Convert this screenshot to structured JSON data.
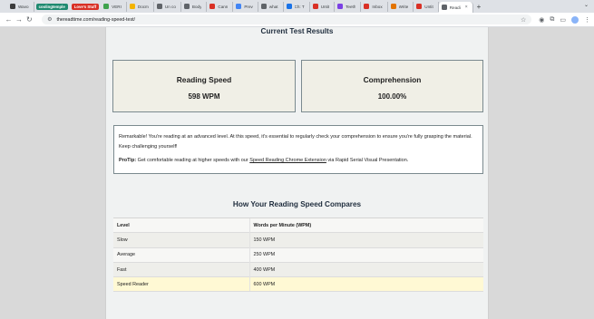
{
  "browser": {
    "tabs": [
      {
        "title": "Wavo",
        "color": "#3c3c3c"
      },
      {
        "pill": "coolingtemple",
        "color": "#1f8a70"
      },
      {
        "pill": "Love's Stuff",
        "color": "#d93025"
      },
      {
        "title": "VERI",
        "color": "#3fa34d"
      },
      {
        "title": "Docm",
        "color": "#f4b400"
      },
      {
        "title": "Un co",
        "color": "#5f6368"
      },
      {
        "title": "Body",
        "color": "#5f6368"
      },
      {
        "title": "Cann",
        "color": "#d93025"
      },
      {
        "title": "Prev",
        "color": "#4285f4"
      },
      {
        "title": "what",
        "color": "#5f6368"
      },
      {
        "title": "Ch: T",
        "color": "#1a73e8"
      },
      {
        "title": "Untit",
        "color": "#d93025"
      },
      {
        "title": "Teeth",
        "color": "#7b3fe4"
      },
      {
        "title": "Inbox",
        "color": "#d93025"
      },
      {
        "title": "Write",
        "color": "#e37400"
      },
      {
        "title": "Untit",
        "color": "#d93025"
      },
      {
        "title": "Readi",
        "color": "#5f6368",
        "active": true
      }
    ],
    "url": "thereadtime.com/reading-speed-test/"
  },
  "results": {
    "title": "Current Test Results",
    "speed_label": "Reading Speed",
    "speed_value": "598 WPM",
    "comprehension_label": "Comprehension",
    "comprehension_value": "100.00%"
  },
  "notice": {
    "message": "Remarkable! You're reading at an advanced level. At this speed, it's essential to regularly check your comprehension to ensure you're fully grasping the material. Keep challenging yourself!",
    "protip_label": "ProTip:",
    "protip_text": " Get comfortable reading at higher speeds with our ",
    "protip_link": "Speed Reading Chrome Extension",
    "protip_suffix": " via Rapid Serial Visual Presentation."
  },
  "comparison": {
    "title": "How Your Reading Speed Compares",
    "headers": [
      "Level",
      "Words per Minute (WPM)"
    ],
    "rows": [
      [
        "Slow",
        "150 WPM"
      ],
      [
        "Average",
        "250 WPM"
      ],
      [
        "Fast",
        "400 WPM"
      ],
      [
        "Speed Reader",
        "600 WPM"
      ]
    ],
    "highlight_row": 3
  }
}
